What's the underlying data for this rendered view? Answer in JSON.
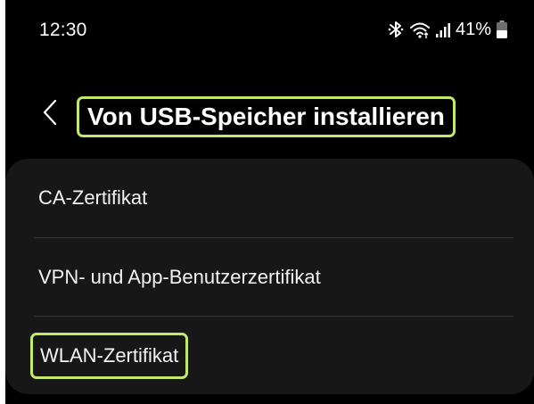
{
  "status_bar": {
    "time": "12:30",
    "battery_percent": "41%",
    "icons": [
      "bluetooth-icon",
      "wifi-icon",
      "signal-icon",
      "battery-icon"
    ]
  },
  "header": {
    "back_icon": "chevron-left-icon",
    "title": "Von USB-Speicher installieren"
  },
  "list": {
    "items": [
      {
        "label": "CA-Zertifikat"
      },
      {
        "label": "VPN- und App-Benutzerzertifikat"
      },
      {
        "label": "WLAN-Zertifikat"
      }
    ]
  },
  "colors": {
    "background": "#000000",
    "card": "#171717",
    "text": "#ffffff",
    "highlight": "#c3e86a",
    "divider": "#383838"
  }
}
